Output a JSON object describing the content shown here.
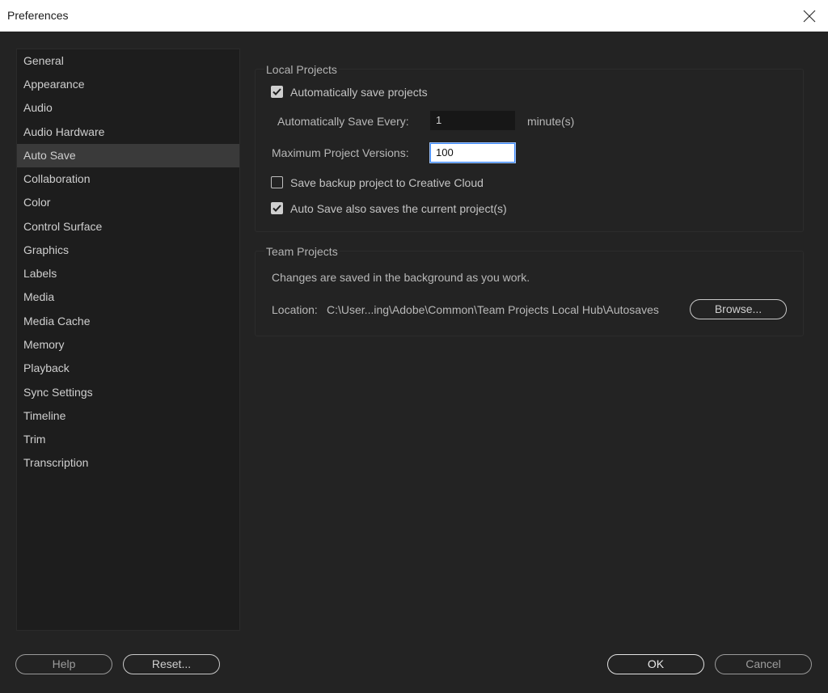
{
  "window": {
    "title": "Preferences"
  },
  "sidebar": {
    "items": [
      {
        "label": "General"
      },
      {
        "label": "Appearance"
      },
      {
        "label": "Audio"
      },
      {
        "label": "Audio Hardware"
      },
      {
        "label": "Auto Save"
      },
      {
        "label": "Collaboration"
      },
      {
        "label": "Color"
      },
      {
        "label": "Control Surface"
      },
      {
        "label": "Graphics"
      },
      {
        "label": "Labels"
      },
      {
        "label": "Media"
      },
      {
        "label": "Media Cache"
      },
      {
        "label": "Memory"
      },
      {
        "label": "Playback"
      },
      {
        "label": "Sync Settings"
      },
      {
        "label": "Timeline"
      },
      {
        "label": "Trim"
      },
      {
        "label": "Transcription"
      }
    ],
    "selected": "Auto Save"
  },
  "local_projects": {
    "title": "Local Projects",
    "auto_save_checkbox": {
      "label": "Automatically save projects",
      "checked": true
    },
    "save_every": {
      "label": "Automatically Save Every:",
      "value": "1",
      "unit": "minute(s)"
    },
    "max_versions": {
      "label": "Maximum Project Versions:",
      "value": "100"
    },
    "backup_checkbox": {
      "label": "Save backup project to Creative Cloud",
      "checked": false
    },
    "current_checkbox": {
      "label": "Auto Save also saves the current project(s)",
      "checked": true
    }
  },
  "team_projects": {
    "title": "Team Projects",
    "description": "Changes are saved in the background as you work.",
    "location_label": "Location:",
    "location_path": "C:\\User...ing\\Adobe\\Common\\Team Projects Local Hub\\Autosaves",
    "browse_label": "Browse..."
  },
  "footer": {
    "help_label": "Help",
    "reset_label": "Reset...",
    "ok_label": "OK",
    "cancel_label": "Cancel"
  },
  "colors": {
    "background": "#232323",
    "sidebar": "#1d1d1d",
    "selected_item": "#3a3a3a",
    "focus_ring": "#3a86ff"
  },
  "icons": {
    "close": "close-icon",
    "check": "check-icon"
  }
}
